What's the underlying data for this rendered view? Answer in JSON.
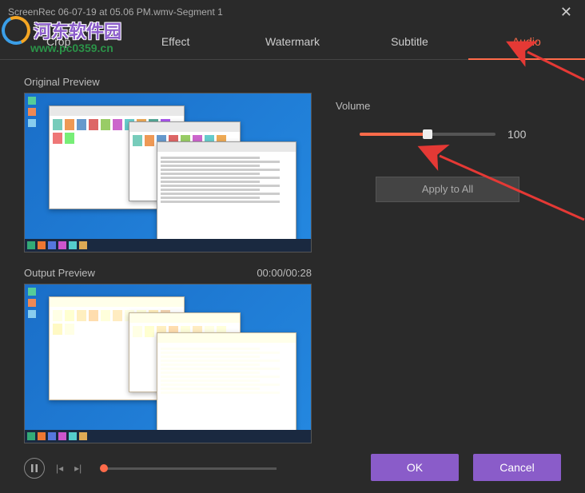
{
  "window": {
    "title": "ScreenRec 06-07-19 at 05.06 PM.wmv-Segment 1"
  },
  "tabs": {
    "crop": "Crop",
    "effect": "Effect",
    "watermark": "Watermark",
    "subtitle": "Subtitle",
    "audio": "Audio",
    "active": "audio"
  },
  "previews": {
    "original_label": "Original Preview",
    "output_label": "Output Preview",
    "output_time": "00:00/00:28"
  },
  "audio": {
    "volume_label": "Volume",
    "volume_value": "100",
    "volume_percent": 50,
    "apply_label": "Apply to All"
  },
  "actions": {
    "ok": "OK",
    "cancel": "Cancel"
  },
  "watermark": {
    "text": "河东软件园",
    "url": "www.pc0359.cn"
  }
}
